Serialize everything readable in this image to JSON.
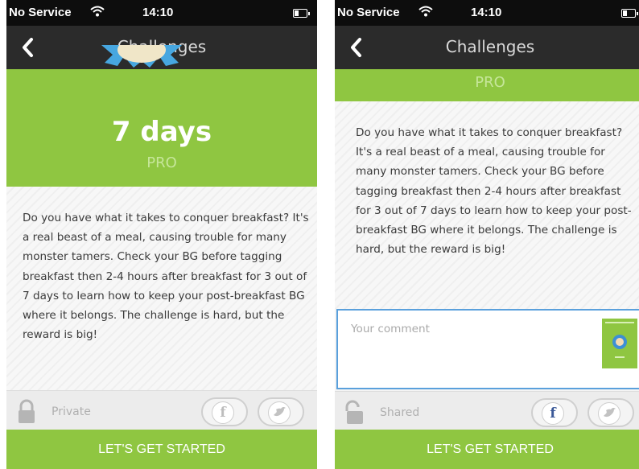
{
  "status_bar": {
    "carrier": "No Service",
    "time": "14:10"
  },
  "nav": {
    "title": "Challenges"
  },
  "challenge": {
    "duration": "7 days",
    "level": "PRO",
    "description": "Do you have what it takes to conquer breakfast? It's a real beast of a meal, causing trouble for many monster tamers. Check your BG before tagging breakfast then 2-4 hours after breakfast for 3 out of 7 days to learn how to keep your post-breakfast BG where it belongs. The challenge is hard, but the reward is big!"
  },
  "left_screen": {
    "privacy_label": "Private"
  },
  "right_screen": {
    "privacy_label": "Shared",
    "comment_placeholder": "Your comment"
  },
  "social": {
    "facebook_glyph": "f",
    "twitter_glyph": "t"
  },
  "cta": {
    "label": "LET'S GET STARTED"
  },
  "colors": {
    "brand_green": "#8fc641",
    "nav_dark": "#2b2b2b",
    "status_black": "#0d0d0d",
    "focus_blue": "#5aa0dc",
    "facebook_blue": "#3b5998"
  }
}
